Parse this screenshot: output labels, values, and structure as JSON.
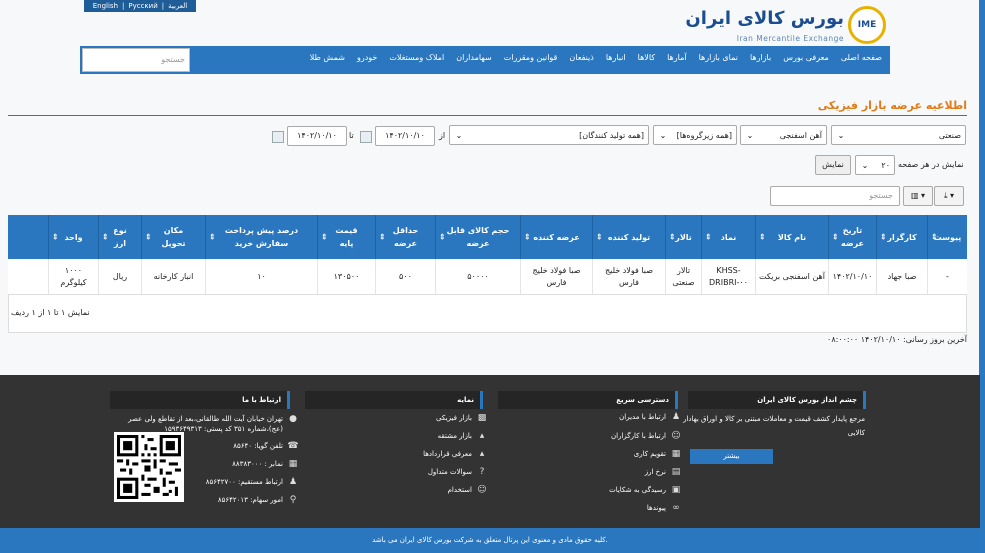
{
  "lang": {
    "english": "English",
    "russian": "Pyccкий",
    "arabic": "العربية",
    "sep": "|"
  },
  "logo": {
    "fa": "بورس کالای ایران",
    "en": "Iran Mercantile Exchange",
    "mark": "IME"
  },
  "nav": {
    "items": [
      "صفحه اصلی",
      "معرفی بورس",
      "بازارها",
      "نمای بازارها",
      "آمارها",
      "کالاها",
      "انبارها",
      "ذینفعان",
      "قوانین ومقررات",
      "سهامداران",
      "املاک ومستغلات",
      "خودرو",
      "شمش طلا"
    ],
    "search_placeholder": "جستجو"
  },
  "page_title": "اطلاعیه عرضه بازار فیزیکی",
  "filters": {
    "market": "صنعتی",
    "group": "آهن اسفنجی",
    "subgroup": "[همه زیرگروه‌ها]",
    "producers": "[همه تولید کنندگان]",
    "from_label": "از",
    "from_date": "۱۴۰۲/۱۰/۱۰",
    "to_label": "تا",
    "to_date": "۱۴۰۲/۱۰/۱۰"
  },
  "paging": {
    "label": "نمایش در هر صفحه",
    "value": "۲۰",
    "show_btn": "نمایش"
  },
  "grid_search_placeholder": "جستجو",
  "toolbar": {
    "columns_icon": "▥ ▾",
    "export_icon": "⤓ ▾"
  },
  "table": {
    "headers": [
      "پیوست",
      "کارگزار",
      "تاریخ عرضه",
      "نام کالا",
      "نماد",
      "تالار",
      "تولید کننده",
      "عرضه کننده",
      "حجم کالای قابل عرضه",
      "حداقل عرضه",
      "قیمت پایه",
      "درصد پیش پرداخت سفارش خرید",
      "مکان تحویل",
      "نوع ارز",
      "واحد"
    ],
    "rows": [
      [
        "-",
        "صبا جهاد",
        "۱۴۰۲/۱۰/۱۰",
        "آهن اسفنجی بریکت",
        "KHSS-DRIBRI-۰۰",
        "تالار صنعتی",
        "صبا فولاد خلیج فارس",
        "صبا فولاد خلیج فارس",
        "۵۰۰۰۰",
        "۵۰۰",
        "۱۳۰۵۰۰",
        "۱۰",
        "انبار کارخانه",
        "ریال",
        "۱۰۰۰ کیلوگرم"
      ]
    ],
    "footer": "نمایش ۱ تا ۱ از ۱ ردیف"
  },
  "last_update": "آخرین بروز رسانی: ۱۴۰۲/۱۰/۱۰ ۰۸:۰۰:۰۰",
  "footer": {
    "about_title": "چشم انداز بورس کالای ایران",
    "about_text_1": "مرجع پایدار کشف قیمت و معاملات مبتنی بر کالا و اوراق بهادار",
    "about_text_2": "کالایی",
    "more": "بیشتر",
    "quick_title": "دسترسی سریع",
    "quick": [
      "ارتباط با مدیران",
      "ارتباط با کارگزاران",
      "تقویم کاری",
      "نرخ ارز",
      "رسیدگی به شکایات",
      "پیوندها"
    ],
    "index_title": "نمایه",
    "index": [
      "بازار فیزیکی",
      "بازار مشتقه",
      "معرفی قراردادها",
      "سوالات متداول",
      "استخدام"
    ],
    "contact_title": "ارتباط با ما",
    "address_1": "تهران خیابان آیت الله طالقانی،بعد از تقاطع ولی عصر",
    "address_2": "(عج)،شماره ۳۵۱ کد پستی: ۱۵۹۳۶۴۹۳۱۳",
    "phone": "تلفن گویا: ۸۵۶۴۰",
    "fax": "نمابر : ۸۸۳۸۳۰۰۰",
    "direct": "ارتباط مستقیم: ۸۵۶۴۲۷۰۰",
    "shares": "امور سهام: ۸۵۶۴۲۰۱۳"
  },
  "copyright": "کلیه حقوق مادی و معنوی این پرتال متعلق به شرکت بورس کالای ایران می باشد."
}
